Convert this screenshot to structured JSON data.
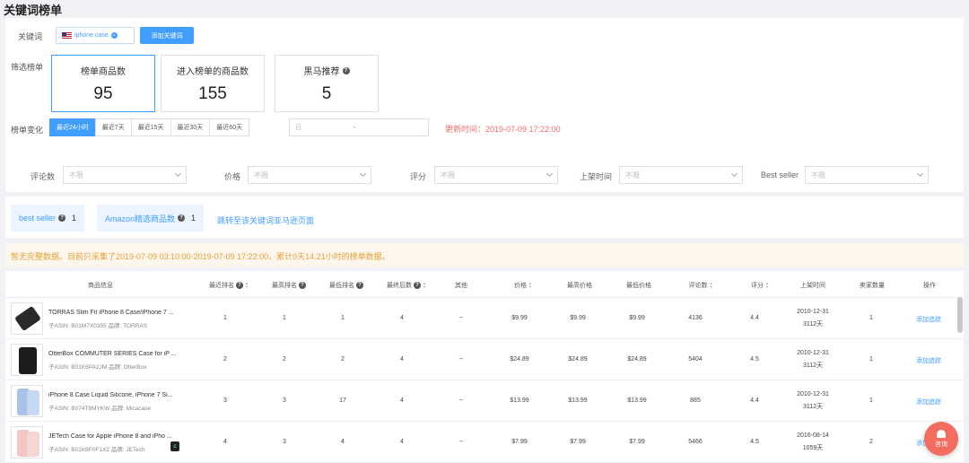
{
  "page_title": "关键词榜单",
  "keyword": {
    "label": "关键词",
    "chip_text": "iphone case",
    "add_button": "添加关键词"
  },
  "filter_list": {
    "label": "筛选榜单",
    "boxes": [
      {
        "label": "榜单商品数",
        "value": "95"
      },
      {
        "label": "进入榜单的商品数",
        "value": "155"
      },
      {
        "label": "黑马推荐",
        "value": "5"
      }
    ]
  },
  "rank_change": {
    "label": "榜单变化",
    "ranges": [
      "最近24小时",
      "最近7天",
      "最近15天",
      "最近30天",
      "最近60天"
    ],
    "date_placeholder": "日",
    "date_sep": "-",
    "update_time": "更新时间：2019-07-09 17:22:00"
  },
  "filters": [
    {
      "label": "评论数",
      "placeholder": "不限"
    },
    {
      "label": "价格",
      "placeholder": "不限"
    },
    {
      "label": "评分",
      "placeholder": "不限"
    },
    {
      "label": "上架时间",
      "placeholder": "不限"
    },
    {
      "label": "Best seller",
      "placeholder": "不限"
    }
  ],
  "tags": [
    {
      "label": "best seller",
      "count": "1"
    },
    {
      "label": "Amazon精选商品数",
      "count": "1"
    }
  ],
  "tag_link": "跳转至该关键词亚马逊页面",
  "warning": "暂无完整数据。目前只采集了2019-07-09 03:10:00-2019-07-09 17:22:00，累计0天14.21小时的榜单数据。",
  "table": {
    "headers": [
      "商品信息",
      "最近排名",
      "最高排名",
      "最低排名",
      "最终后数",
      "其他",
      "价格",
      "最高价格",
      "最低价格",
      "评论数",
      "评分",
      "上架时间",
      "卖家数量",
      "操作"
    ],
    "rows": [
      {
        "title": "TORRAS Slim Fit iPhone 8 Case/iPhone 7 ...",
        "sub": "子ASIN: B01M7X0355   品牌: TORRAS",
        "recent": "1",
        "high": "1",
        "low": "1",
        "final": "4",
        "other": "--",
        "price": "$9.99",
        "max_price": "$9.99",
        "min_price": "$9.99",
        "reviews": "4136",
        "rating": "4.4",
        "date": "2010-12-31",
        "days": "3112天",
        "sellers": "1",
        "op": "添加追踪"
      },
      {
        "title": "OtterBox COMMUTER SERIES Case for iP ...",
        "sub": "子ASIN: B01K6PA2JM   品牌: OtterBox",
        "recent": "2",
        "high": "2",
        "low": "2",
        "final": "4",
        "other": "--",
        "price": "$24.89",
        "max_price": "$24.89",
        "min_price": "$24.89",
        "reviews": "5404",
        "rating": "4.5",
        "date": "2010-12-31",
        "days": "3112天",
        "sellers": "1",
        "op": "添加追踪"
      },
      {
        "title": "iPhone 8 Case Liquid Silicone, iPhone 7 Si...",
        "sub": "子ASIN: B074T8MYKW   品牌: Micacase",
        "recent": "3",
        "high": "3",
        "low": "17",
        "final": "4",
        "other": "--",
        "price": "$13.99",
        "max_price": "$13.99",
        "min_price": "$13.99",
        "reviews": "885",
        "rating": "4.4",
        "date": "2010-12-31",
        "days": "3112天",
        "sellers": "1",
        "op": "添加追踪"
      },
      {
        "title": "JETech Case for Apple iPhone 8 and iPho ...",
        "sub": "子ASIN: B01K6F0F1X2   品牌: JETech",
        "recent": "4",
        "high": "3",
        "low": "4",
        "final": "4",
        "other": "--",
        "price": "$7.99",
        "max_price": "$7.99",
        "min_price": "$7.99",
        "reviews": "5466",
        "rating": "4.5",
        "date": "2016-08-14",
        "days": "1059天",
        "sellers": "2",
        "op": "添加追踪"
      }
    ]
  },
  "float_button": "咨询",
  "colors": {
    "accent": "#409eff",
    "warning_bg": "#fdf6ec",
    "warning_text": "#e6a23c",
    "update_time": "#f56c6c",
    "float_btn": "#f26d60"
  }
}
